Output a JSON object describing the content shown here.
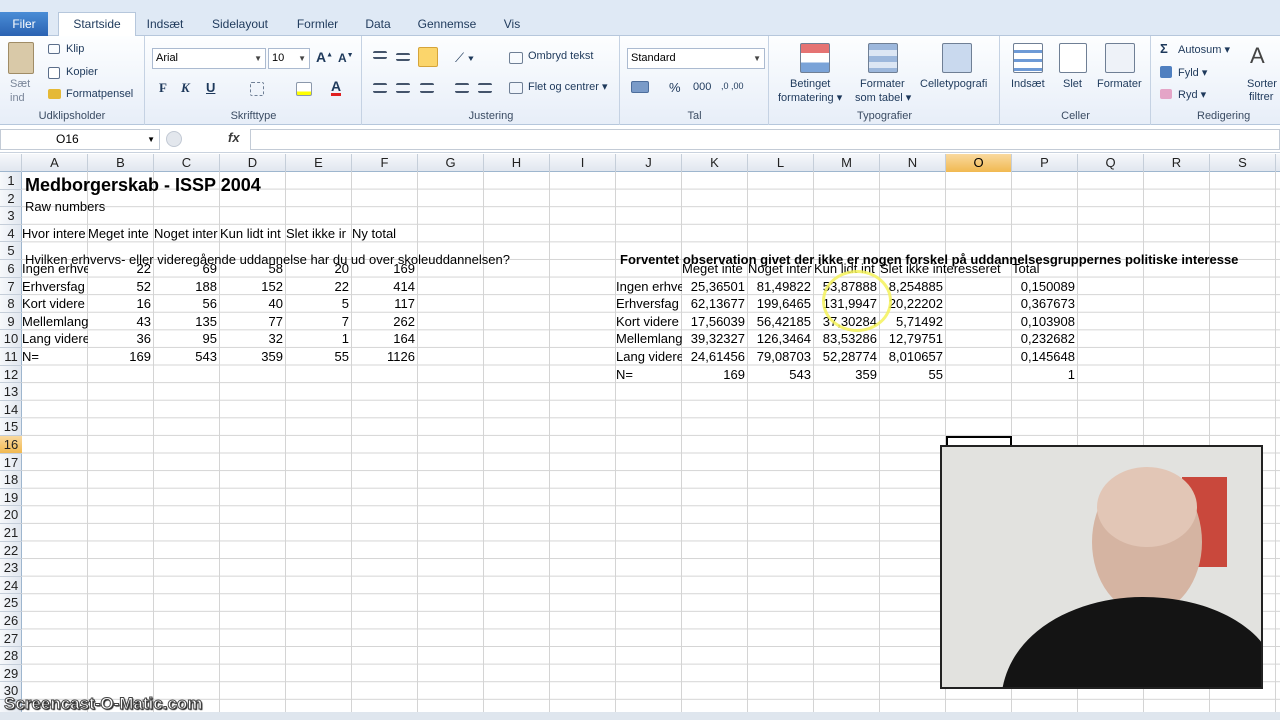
{
  "ribbon_tabs": [
    "Filer",
    "Startside",
    "Indsæt",
    "Sidelayout",
    "Formler",
    "Data",
    "Gennemse",
    "Vis"
  ],
  "clipboard": {
    "paste": "Sæt",
    "paste2": "ind",
    "cut": "Klip",
    "copy": "Kopier",
    "painter": "Formatpensel",
    "label": "Udklipsholder"
  },
  "font": {
    "name": "Arial",
    "size": "10",
    "label": "Skrifttype",
    "bold": "F",
    "italic": "K",
    "underline": "U"
  },
  "alignment": {
    "wrap": "Ombryd tekst",
    "merge": "Flet og centrer",
    "label": "Justering"
  },
  "number": {
    "format": "Standard",
    "label": "Tal",
    "percent": "%",
    "thousand": "000"
  },
  "styles": {
    "cond": "Betinget",
    "cond2": "formatering",
    "table": "Formater",
    "table2": "som tabel",
    "cellstyles": "Celletypografi",
    "label": "Typografier"
  },
  "cells": {
    "insert": "Indsæt",
    "delete": "Slet",
    "format": "Formater",
    "label": "Celler"
  },
  "editing": {
    "autosum": "Autosum",
    "fill": "Fyld",
    "clear": "Ryd",
    "sort": "Sorter",
    "sort2": "filtrer",
    "label": "Redigering"
  },
  "formula_bar": {
    "name_box": "O16",
    "fx": "fx",
    "value": ""
  },
  "columns": [
    "A",
    "B",
    "C",
    "D",
    "E",
    "F",
    "G",
    "H",
    "I",
    "J",
    "K",
    "L",
    "M",
    "N",
    "O",
    "P",
    "Q",
    "R",
    "S"
  ],
  "rows": [
    "1",
    "2",
    "3",
    "4",
    "5",
    "6",
    "7",
    "8",
    "9",
    "10",
    "11",
    "12",
    "13",
    "14",
    "15",
    "16",
    "17",
    "18",
    "19",
    "20",
    "21",
    "22",
    "23",
    "24",
    "25",
    "26",
    "27",
    "28",
    "29",
    "30"
  ],
  "sheet": {
    "title": "Medborgerskab - ISSP 2004",
    "subtitle": "Raw numbers",
    "left_headers": [
      "Hvor intere",
      "Meget inte",
      "Noget inter",
      "Kun lidt int",
      "Slet ikke ir",
      "Ny total"
    ],
    "question": "Hvilken erhvervs- eller videregående uddannelse har du ud over skoleuddannelsen?",
    "left_rows": [
      {
        "label": "Ingen erhve",
        "v": [
          "22",
          "69",
          "58",
          "20",
          "169"
        ]
      },
      {
        "label": "Erhversfag",
        "v": [
          "52",
          "188",
          "152",
          "22",
          "414"
        ]
      },
      {
        "label": "Kort videre",
        "v": [
          "16",
          "56",
          "40",
          "5",
          "117"
        ]
      },
      {
        "label": "Mellemlang",
        "v": [
          "43",
          "135",
          "77",
          "7",
          "262"
        ]
      },
      {
        "label": "Lang videre",
        "v": [
          "36",
          "95",
          "32",
          "1",
          "164"
        ]
      },
      {
        "label": "N=",
        "v": [
          "169",
          "543",
          "359",
          "55",
          "1126"
        ]
      }
    ],
    "right_title": "Forventet observation givet der ikke er nogen forskel på uddannelsesgruppernes politiske interesse",
    "right_headers": [
      "Meget inte",
      "Noget inter",
      "Kun lidt int",
      "Slet ikke interesseret",
      "Total"
    ],
    "right_rows": [
      {
        "label": "Ingen erhve",
        "v": [
          "25,36501",
          "81,49822",
          "53,87888",
          "8,254885",
          "0,150089"
        ]
      },
      {
        "label": "Erhversfag",
        "v": [
          "62,13677",
          "199,6465",
          "131,9947",
          "20,22202",
          "0,367673"
        ]
      },
      {
        "label": "Kort videre",
        "v": [
          "17,56039",
          "56,42185",
          "37,30284",
          "5,71492",
          "0,103908"
        ]
      },
      {
        "label": "Mellemlang",
        "v": [
          "39,32327",
          "126,3464",
          "83,53286",
          "12,79751",
          "0,232682"
        ]
      },
      {
        "label": "Lang videre",
        "v": [
          "24,61456",
          "79,08703",
          "52,28774",
          "8,010657",
          "0,145648"
        ]
      },
      {
        "label": "N=",
        "v": [
          "169",
          "543",
          "359",
          "55",
          "1"
        ]
      }
    ]
  },
  "watermark": "Screencast-O-Matic.com"
}
